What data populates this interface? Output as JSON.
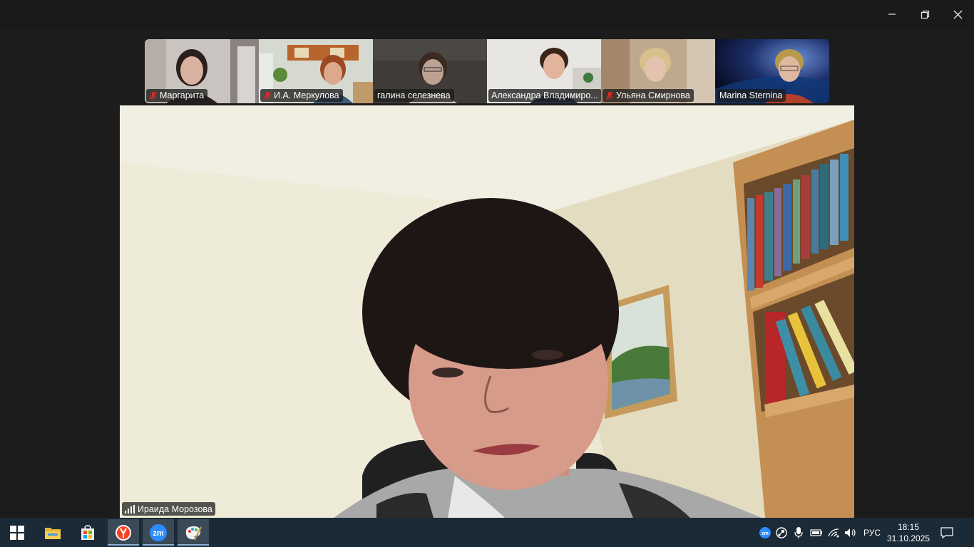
{
  "window": {
    "controls": {
      "minimize_icon": "minimize-icon",
      "restore_icon": "restore-icon",
      "close_icon": "close-icon"
    }
  },
  "gallery": {
    "participants": [
      {
        "name": "Маргарита",
        "muted": true
      },
      {
        "name": "И.А. Меркулова",
        "muted": true
      },
      {
        "name": "галина селезнева",
        "muted": false
      },
      {
        "name": "Александра Владимиро...",
        "muted": false
      },
      {
        "name": "Ульяна Смирнова",
        "muted": true
      },
      {
        "name": "Marina Sternina",
        "muted": false
      }
    ]
  },
  "speaker": {
    "name": "Ираида Морозова",
    "signal_icon": "signal-bars-icon"
  },
  "taskbar": {
    "apps": [
      {
        "id": "start",
        "icon": "windows-start-icon"
      },
      {
        "id": "explorer",
        "icon": "file-explorer-icon"
      },
      {
        "id": "store",
        "icon": "microsoft-store-icon"
      },
      {
        "id": "yandex",
        "icon": "yandex-browser-icon"
      },
      {
        "id": "zoom",
        "icon": "zoom-icon"
      },
      {
        "id": "paint",
        "icon": "paint-icon"
      }
    ],
    "tray": {
      "language": "РУС",
      "time": "18:15",
      "date": "31.10.2025"
    }
  },
  "colors": {
    "window_bg": "#1c1c1c",
    "taskbar_bg": "#1b2a37",
    "zoom_blue": "#2d8cff",
    "mute_red": "#e02828"
  }
}
